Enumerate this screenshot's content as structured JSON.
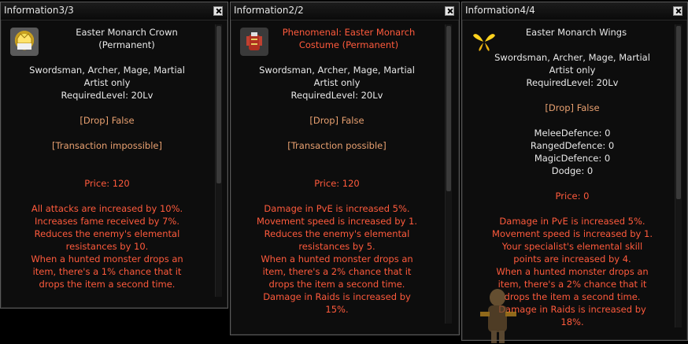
{
  "windows": [
    {
      "title": "Information3/3",
      "item_name": "Easter Monarch Crown\n(Permanent)",
      "requirements": [
        "Swordsman, Archer, Mage, Martial",
        "Artist only",
        "RequiredLevel: 20Lv"
      ],
      "drop": "[Drop] False",
      "transaction": "[Transaction impossible]",
      "price": "Price: 120",
      "effects": [
        "All attacks are increased by 10%.",
        "Increases fame received by 7%.",
        "Reduces the enemy's elemental",
        "resistances by 10.",
        "When a hunted monster drops an",
        "item, there's a 1% chance that it",
        "drops the item a second time."
      ]
    },
    {
      "title": "Information2/2",
      "item_name": "Phenomenal: Easter Monarch\nCostume (Permanent)",
      "requirements": [
        "Swordsman, Archer, Mage, Martial",
        "Artist only",
        "RequiredLevel: 20Lv"
      ],
      "drop": "[Drop] False",
      "transaction": "[Transaction possible]",
      "price": "Price: 120",
      "effects": [
        "Damage in PvE is increased 5%.",
        "Movement speed is increased by 1.",
        "Reduces the enemy's elemental",
        "resistances by 5.",
        "When a hunted monster drops an",
        "item, there's a 2% chance that it",
        "drops the item a second time.",
        "Damage in Raids is increased by",
        "15%."
      ]
    },
    {
      "title": "Information4/4",
      "item_name": "Easter Monarch Wings",
      "requirements": [
        "Swordsman, Archer, Mage, Martial",
        "Artist only",
        "RequiredLevel: 20Lv"
      ],
      "drop": "[Drop] False",
      "defences": [
        "MeleeDefence: 0",
        "RangedDefence: 0",
        "MagicDefence: 0",
        "Dodge: 0"
      ],
      "price": "Price: 0",
      "effects": [
        "Damage in PvE is increased 5%.",
        "Movement speed is increased by 1.",
        "Your specialist's elemental skill",
        "points are increased by 4.",
        "When a hunted monster drops an",
        "item, there's a 2% chance that it",
        "drops the item a second time.",
        "Damage in Raids is increased by",
        "18%."
      ]
    }
  ],
  "icons": [
    "crown-icon",
    "costume-icon",
    "wings-icon",
    "close-icon"
  ],
  "colors": {
    "text_white": "#e8e8e8",
    "text_orange": "#e8a070",
    "text_red": "#ff5a3c",
    "window_bg": "#0d0d0d",
    "border": "#5a5a5a"
  }
}
